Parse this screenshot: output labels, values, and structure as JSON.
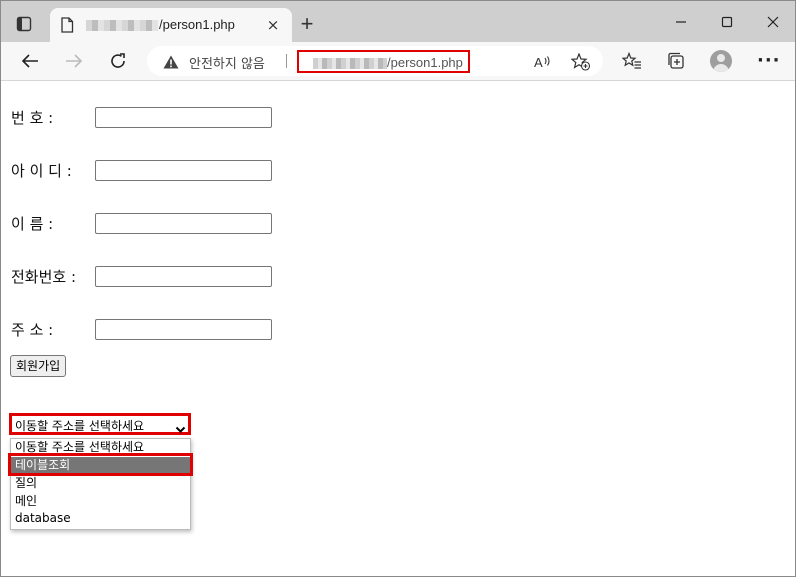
{
  "browser": {
    "tab": {
      "title_suffix": "/person1.php"
    },
    "address_bar": {
      "security_label": "안전하지 않음",
      "url_suffix": "/person1.php"
    },
    "icons": {
      "tab_actions": "tab-actions-icon",
      "new_tab": "+",
      "close_tab": "×",
      "back": "back-arrow-icon",
      "forward": "forward-arrow-icon",
      "refresh": "refresh-icon",
      "read_aloud": "read-aloud-icon",
      "add_favorite": "add-favorite-icon",
      "favorites": "favorites-icon",
      "collections": "collections-icon",
      "more": "···"
    }
  },
  "form": {
    "fields": [
      {
        "label": "번 호 :",
        "value": ""
      },
      {
        "label": "아 이 디 :",
        "value": ""
      },
      {
        "label": "이 름 :",
        "value": ""
      },
      {
        "label": "전화번호 :",
        "value": ""
      },
      {
        "label": "주 소 :",
        "value": ""
      }
    ],
    "submit_label": "회원가입"
  },
  "navigation_select": {
    "selected": "이동할 주소를 선택하세요",
    "options": [
      "이동할 주소를 선택하세요",
      "테이블조회",
      "질의",
      "메인",
      "database"
    ],
    "highlighted_index": 1
  },
  "colors": {
    "annotation_red": "#e00000",
    "highlight_gray": "#767676"
  }
}
